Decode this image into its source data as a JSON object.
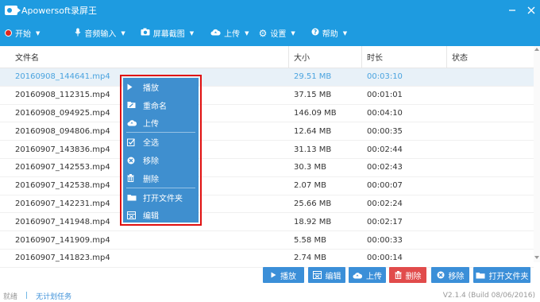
{
  "app": {
    "title": "Apowersoft录屏王"
  },
  "toolbar": {
    "items": [
      {
        "label": "开始",
        "icon": "record-dot-icon"
      },
      {
        "label": "音频输入",
        "icon": "microphone-icon"
      },
      {
        "label": "屏幕截图",
        "icon": "camera-icon"
      },
      {
        "label": "上传",
        "icon": "cloud-upload-icon"
      },
      {
        "label": "设置",
        "icon": "gear-icon"
      },
      {
        "label": "帮助",
        "icon": "help-icon"
      }
    ]
  },
  "table": {
    "headers": {
      "name": "文件名",
      "size": "大小",
      "duration": "时长",
      "status": "状态"
    },
    "rows": [
      {
        "name": "20160908_144641.mp4",
        "size": "29.51 MB",
        "duration": "00:03:10",
        "selected": true
      },
      {
        "name": "20160908_112315.mp4",
        "size": "37.15 MB",
        "duration": "00:01:01"
      },
      {
        "name": "20160908_094925.mp4",
        "size": "146.09 MB",
        "duration": "00:04:10"
      },
      {
        "name": "20160908_094806.mp4",
        "size": "12.64 MB",
        "duration": "00:00:35"
      },
      {
        "name": "20160907_143836.mp4",
        "size": "31.13 MB",
        "duration": "00:02:44"
      },
      {
        "name": "20160907_142553.mp4",
        "size": "30.3 MB",
        "duration": "00:02:43"
      },
      {
        "name": "20160907_142538.mp4",
        "size": "2.07 MB",
        "duration": "00:00:07"
      },
      {
        "name": "20160907_142231.mp4",
        "size": "25.66 MB",
        "duration": "00:02:24"
      },
      {
        "name": "20160907_141948.mp4",
        "size": "18.92 MB",
        "duration": "00:02:17"
      },
      {
        "name": "20160907_141909.mp4",
        "size": "5.58 MB",
        "duration": "00:00:33"
      },
      {
        "name": "20160907_141823.mp4",
        "size": "2.74 MB",
        "duration": "00:00:14"
      }
    ]
  },
  "context_menu": {
    "items": [
      {
        "label": "播放",
        "icon": "play-icon"
      },
      {
        "label": "重命名",
        "icon": "rename-icon"
      },
      {
        "label": "上传",
        "icon": "cloud-upload-icon"
      },
      {
        "label": "全选",
        "icon": "select-all-icon"
      },
      {
        "label": "移除",
        "icon": "remove-icon"
      },
      {
        "label": "删除",
        "icon": "trash-icon"
      },
      {
        "label": "打开文件夹",
        "icon": "folder-icon"
      },
      {
        "label": "编辑",
        "icon": "edit-icon"
      }
    ]
  },
  "actions": {
    "play": "播放",
    "edit": "编辑",
    "upload": "上传",
    "delete": "删除",
    "remove": "移除",
    "open_folder": "打开文件夹"
  },
  "statusbar": {
    "ready": "就绪",
    "separator": "|",
    "task": "无计划任务",
    "version": "V2.1.4 (Build 08/06/2016)"
  },
  "colors": {
    "primary": "#1e9be0",
    "button": "#3b8fd8",
    "danger": "#e14b4b",
    "menu": "#3f8fcf",
    "highlight": "#e01010",
    "selected_row": "#e8f1f8"
  }
}
